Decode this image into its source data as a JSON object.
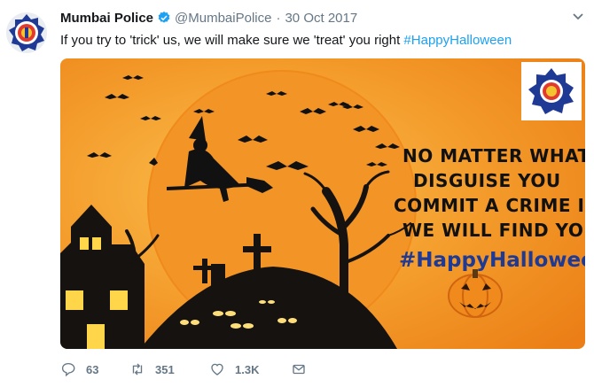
{
  "tweet": {
    "author_name": "Mumbai Police",
    "handle": "@MumbaiPolice",
    "separator": "·",
    "date": "30 Oct 2017",
    "text": "If you try to 'trick' us, we will make sure we 'treat' you right ",
    "hashtag": "#HappyHalloween"
  },
  "media": {
    "lines": [
      "NO MATTER WHAT",
      "DISGUISE YOU",
      "COMMIT A CRIME IN,",
      "WE WILL FIND YOU"
    ],
    "hashtag": "#HappyHalloween"
  },
  "actions": {
    "replies": "63",
    "retweets": "351",
    "likes": "1.3K"
  },
  "icons": {
    "reply": "reply-icon",
    "retweet": "retweet-icon",
    "like": "heart-icon",
    "message": "envelope-icon",
    "verified": "verified-badge-icon",
    "more": "chevron-down-icon"
  },
  "colors": {
    "link_blue": "#1da1f2",
    "muted": "#657786",
    "halloween_orange": "#f08a1c",
    "police_blue": "#1f3a94"
  }
}
